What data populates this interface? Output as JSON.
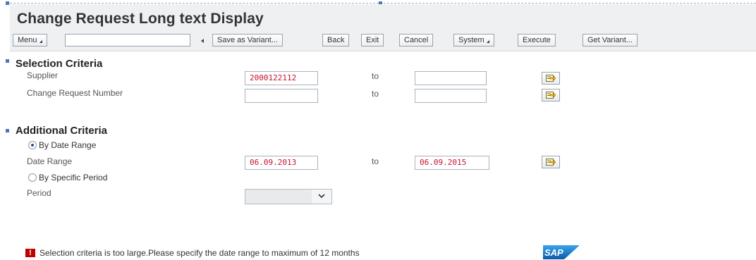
{
  "window": {
    "title": "Change Request Long text Display"
  },
  "toolbar": {
    "menu_label": "Menu",
    "command_field_value": "",
    "buttons": {
      "save_as_variant": "Save as Variant...",
      "back": "Back",
      "exit": "Exit",
      "cancel": "Cancel",
      "system": "System",
      "execute": "Execute",
      "get_variant": "Get Variant..."
    }
  },
  "selection_criteria": {
    "title": "Selection Criteria",
    "supplier": {
      "label": "Supplier",
      "from_value": "2000122112",
      "to_label": "to",
      "to_value": ""
    },
    "change_request_number": {
      "label": "Change Request Number",
      "from_value": "",
      "to_label": "to",
      "to_value": ""
    }
  },
  "additional_criteria": {
    "title": "Additional Criteria",
    "by_date_range": {
      "label": "By Date Range",
      "selected": true
    },
    "date_range": {
      "label": "Date Range",
      "from_value": "06.09.2013",
      "to_label": "to",
      "to_value": "06.09.2015"
    },
    "by_specific_period": {
      "label": "By Specific Period",
      "selected": false
    },
    "period": {
      "label": "Period",
      "value": ""
    }
  },
  "status_bar": {
    "type": "error",
    "icon_glyph": "!",
    "message": "Selection criteria is too large.Please specify the date range to maximum of 12 months"
  },
  "brand": {
    "logo_text": "SAP",
    "logo_color": "#1c6fc4"
  },
  "colors": {
    "input_value": "#c8102e",
    "error": "#c00000",
    "header_bg": "#eef0f2"
  }
}
